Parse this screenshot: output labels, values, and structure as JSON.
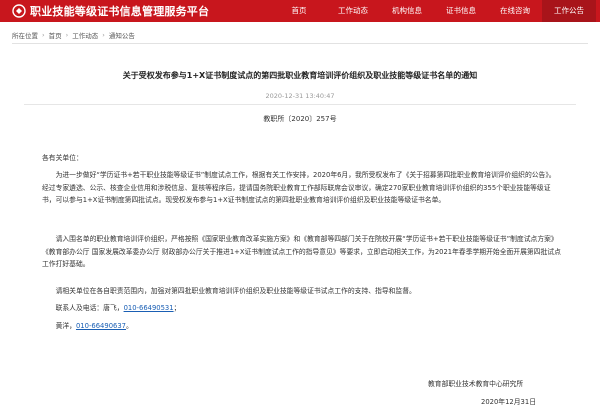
{
  "header": {
    "site_title": "职业技能等级证书信息管理服务平台",
    "nav": [
      {
        "label": "首页"
      },
      {
        "label": "工作动态"
      },
      {
        "label": "机构信息"
      },
      {
        "label": "证书信息"
      },
      {
        "label": "在线咨询"
      },
      {
        "label": "工作公告"
      }
    ],
    "active_index": 5,
    "brand_color": "#c8161d"
  },
  "breadcrumb": {
    "prefix": "所在位置",
    "items": [
      "首页",
      "工作动态",
      "通知公告"
    ]
  },
  "article": {
    "title": "关于受权发布参与1+X证书制度试点的第四批职业教育培训评价组织及职业技能等级证书名单的通知",
    "date": "2020-12-31 13:40:47",
    "doc_number": "教职所〔2020〕257号",
    "salutation": "各有关单位：",
    "paragraphs": [
      "为进一步做好“学历证书+若干职业技能等级证书”制度试点工作，根据有关工作安排，2020年6月，我所受权发布了《关于招募第四批职业教育培训评价组织的公告》。经过专家遴选、公示、核查企业信用和涉税信息、复核等程序后，提请国务院职业教育工作部际联席会议审议，确定270家职业教育培训评价组织的355个职业技能等级证书，可以参与1+X证书制度第四批试点。现受权发布参与1+X证书制度试点的第四批职业教育培训评价组织及职业技能等级证书名单。",
      "请入围名单的职业教育培训评价组织，严格按照《国家职业教育改革实施方案》和《教育部等四部门关于在院校开展“学历证书+若干职业技能等级证书”制度试点方案》《教育部办公厅 国家发展改革委办公厅 财政部办公厅关于推进1+X证书制度试点工作的指导意见》等要求，立即启动相关工作，为2021年春季学期开始全面开展第四批试点工作打好基础。",
      "请相关单位在各自职责范围内，加强对第四批职业教育培训评价组织及职业技能等级证书试点工作的支持、指导和监督。"
    ],
    "contacts": {
      "label": "联系人及电话：",
      "person1_name": "唐飞，",
      "person1_phone": "010-66490531",
      "person1_end": "；",
      "person2_name": "黄洋，",
      "person2_phone": "010-66490637",
      "person2_end": "。"
    },
    "signature_org": "教育部职业技术教育中心研究所",
    "signature_date": "2020年12月31日"
  }
}
